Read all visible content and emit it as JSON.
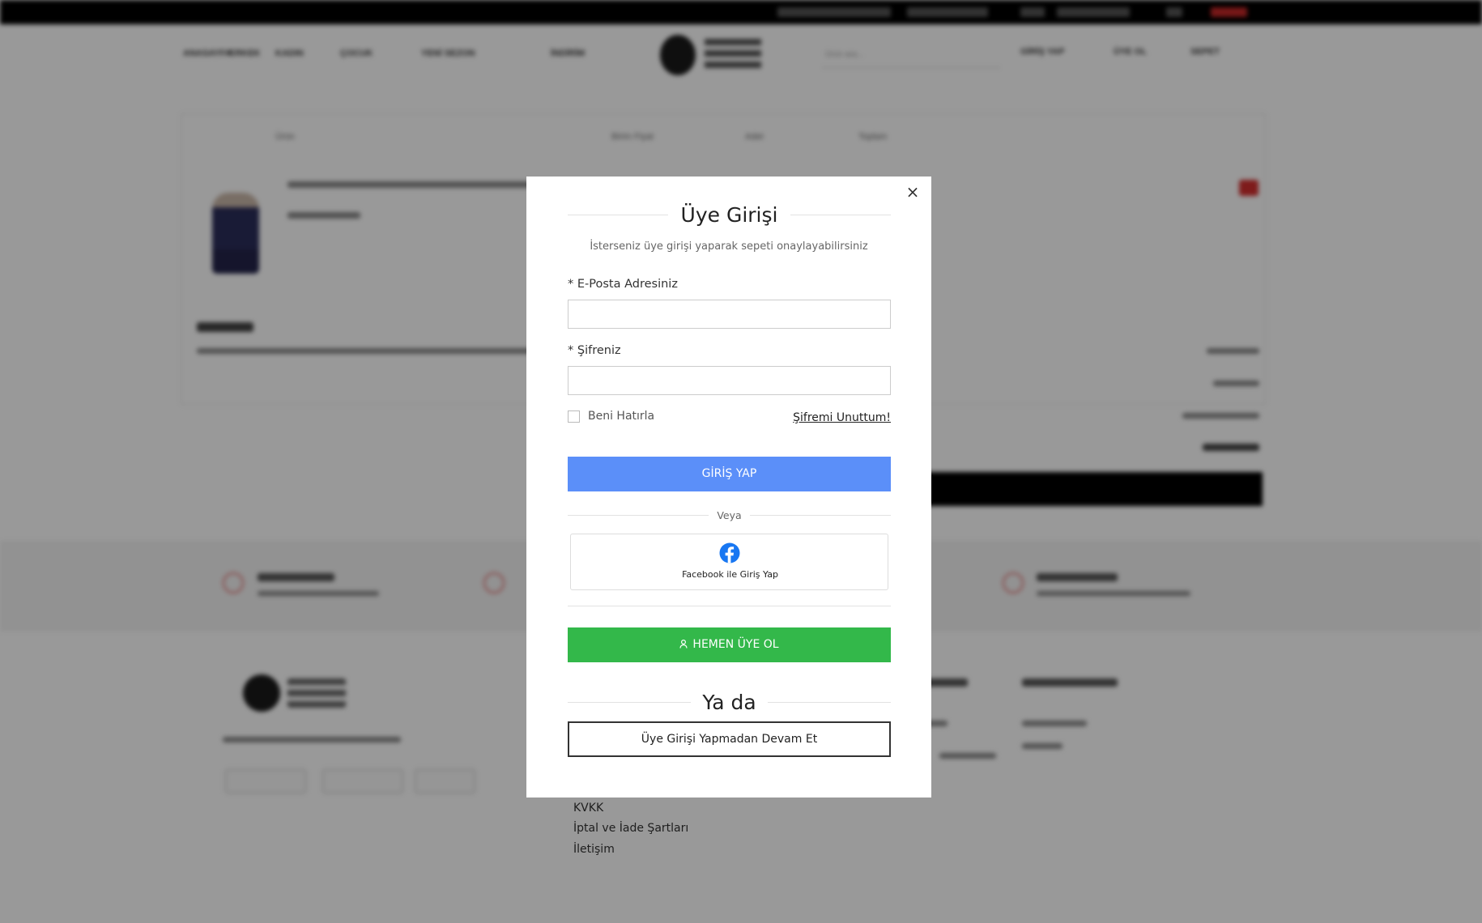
{
  "background": {
    "nav_items": [
      "ANASAYFA",
      "ERKEK",
      "KADIN",
      "ÇOCUK",
      "YENİ SEZON",
      "İNDİRİM"
    ],
    "search_placeholder": "Ürün ara...",
    "header_links": [
      "GİRİŞ YAP",
      "ÜYE OL",
      "SEPET"
    ],
    "cart_headers": [
      "Ürün",
      "Birim Fiyat",
      "Adet",
      "Toplam"
    ],
    "footer_links": [
      "KVKK",
      "İptal ve İade Şartları",
      "İletişim"
    ]
  },
  "modal": {
    "close_label": "×",
    "title": "Üye Girişi",
    "subtitle": "İsterseniz üye girişi yaparak sepeti onaylayabilirsiniz",
    "email_label": "* E-Posta Adresiniz",
    "email_value": "",
    "password_label": "* Şifreniz",
    "password_value": "",
    "remember_label": "Beni Hatırla",
    "forgot_label": "Şifremi Unuttum!",
    "login_button": "GİRİŞ YAP",
    "separator": "Veya",
    "facebook_button": "Facebook ile Giriş Yap",
    "register_button": "HEMEN ÜYE OL",
    "or_text": "Ya da",
    "guest_button": "Üye Girişi Yapmadan Devam Et"
  },
  "colors": {
    "login_blue": "#5b8ff9",
    "register_green": "#33b84a",
    "facebook_blue": "#1877f2",
    "overlay": "rgba(0,0,0,0.4)"
  },
  "icons": {
    "close": "close-icon",
    "facebook": "facebook-icon",
    "user": "user-icon"
  }
}
